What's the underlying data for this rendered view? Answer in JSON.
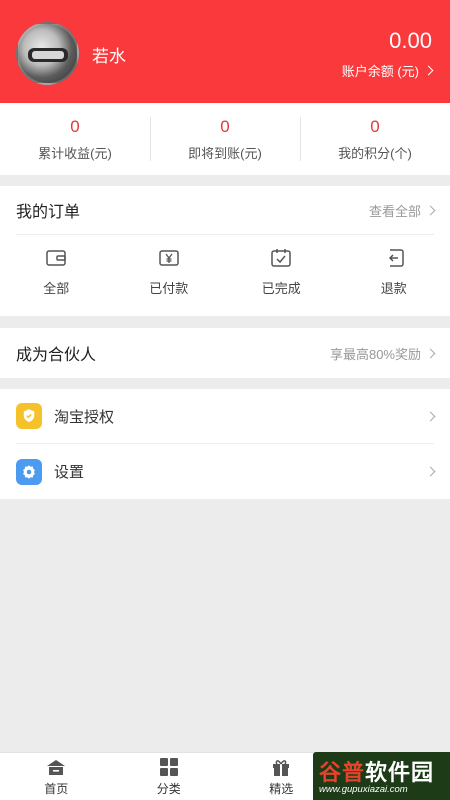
{
  "profile": {
    "username": "若水",
    "balance": "0.00",
    "balance_label": "账户余额 (元)"
  },
  "stats": [
    {
      "value": "0",
      "label": "累计收益(元)"
    },
    {
      "value": "0",
      "label": "即将到账(元)"
    },
    {
      "value": "0",
      "label": "我的积分(个)"
    }
  ],
  "orders": {
    "title": "我的订单",
    "view_all": "查看全部",
    "items": [
      {
        "label": "全部",
        "icon": "wallet-icon"
      },
      {
        "label": "已付款",
        "icon": "paid-icon"
      },
      {
        "label": "已完成",
        "icon": "completed-icon"
      },
      {
        "label": "退款",
        "icon": "refund-icon"
      }
    ]
  },
  "partner": {
    "title": "成为合伙人",
    "reward": "享最高80%奖励"
  },
  "menu": [
    {
      "label": "淘宝授权",
      "icon": "shield-check-icon",
      "color": "#f6c22b"
    },
    {
      "label": "设置",
      "icon": "gear-icon",
      "color": "#4b9bf0"
    }
  ],
  "tabbar": [
    {
      "label": "首页",
      "icon": "home-icon"
    },
    {
      "label": "分类",
      "icon": "grid-icon"
    },
    {
      "label": "精选",
      "icon": "gift-icon"
    }
  ],
  "watermark": {
    "title_part1": "谷普",
    "title_part2": "软件园",
    "url": "www.gupuxiazai.com"
  },
  "colors": {
    "brand": "#f9393b",
    "accent_red": "#e03a3a"
  }
}
